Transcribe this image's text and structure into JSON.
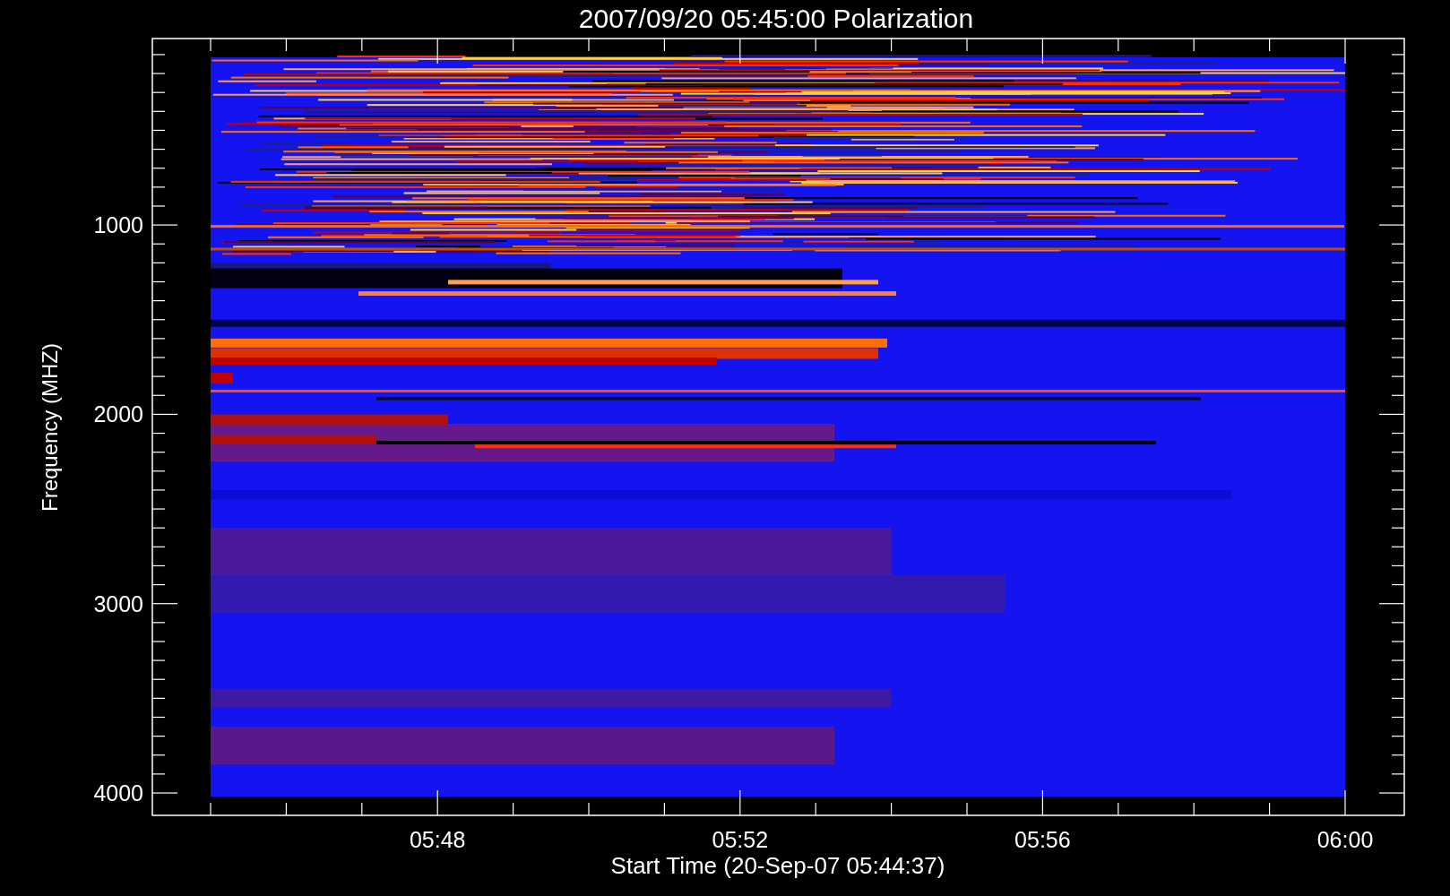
{
  "title": "2007/09/20 05:45:00 Polarization",
  "y_axis": {
    "label": "Frequency (MHZ)",
    "tick_labels": [
      "1000",
      "2000",
      "3000",
      "4000"
    ]
  },
  "x_axis": {
    "label": "Start Time (20-Sep-07 05:44:37)",
    "tick_labels": [
      "05:48",
      "05:52",
      "05:56",
      "06:00"
    ]
  }
}
